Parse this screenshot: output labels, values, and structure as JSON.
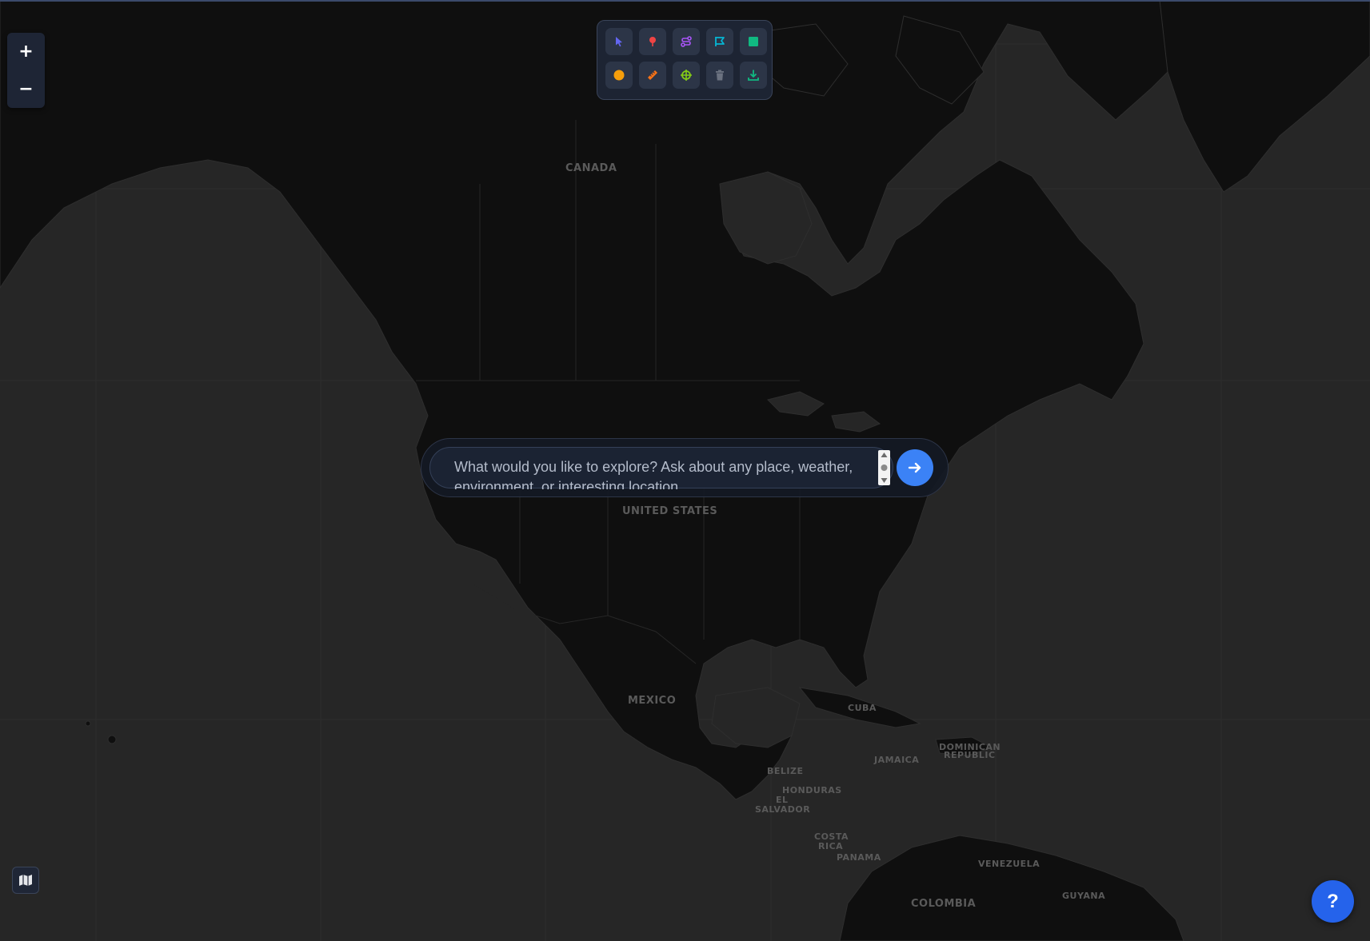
{
  "map": {
    "background_color": "#262626",
    "land_color": "#0f0f0f",
    "border_color": "#2e2e2e",
    "labels": [
      {
        "id": "canada",
        "text": "CANADA"
      },
      {
        "id": "united-states",
        "text": "UNITED STATES"
      },
      {
        "id": "mexico",
        "text": "MEXICO"
      },
      {
        "id": "cuba",
        "text": "CUBA"
      },
      {
        "id": "jamaica",
        "text": "JAMAICA"
      },
      {
        "id": "dominican-republic-1",
        "text": "DOMINICAN"
      },
      {
        "id": "dominican-republic-2",
        "text": "REPUBLIC"
      },
      {
        "id": "belize",
        "text": "BELIZE"
      },
      {
        "id": "honduras",
        "text": "HONDURAS"
      },
      {
        "id": "el-salvador-1",
        "text": "EL"
      },
      {
        "id": "el-salvador-2",
        "text": "SALVADOR"
      },
      {
        "id": "costa-rica-1",
        "text": "COSTA"
      },
      {
        "id": "costa-rica-2",
        "text": "RICA"
      },
      {
        "id": "panama",
        "text": "PANAMA"
      },
      {
        "id": "venezuela",
        "text": "VENEZUELA"
      },
      {
        "id": "colombia",
        "text": "COLOMBIA"
      },
      {
        "id": "guyana",
        "text": "GUYANA"
      }
    ]
  },
  "zoom": {
    "in_label": "+",
    "out_label": "−"
  },
  "toolbar": {
    "tools": [
      {
        "id": "select",
        "icon": "cursor-icon",
        "color": "#6366f1"
      },
      {
        "id": "marker",
        "icon": "map-pin-icon",
        "color": "#ef4444"
      },
      {
        "id": "route",
        "icon": "route-icon",
        "color": "#a855f7"
      },
      {
        "id": "polygon",
        "icon": "polygon-flag-icon",
        "color": "#06b6d4"
      },
      {
        "id": "rectangle",
        "icon": "square-icon",
        "color": "#10b981"
      },
      {
        "id": "circle",
        "icon": "circle-icon",
        "color": "#f59e0b"
      },
      {
        "id": "measure",
        "icon": "ruler-icon",
        "color": "#f97316"
      },
      {
        "id": "locate",
        "icon": "crosshair-icon",
        "color": "#84cc16"
      },
      {
        "id": "delete",
        "icon": "trash-icon",
        "color": "#6b7280"
      },
      {
        "id": "export",
        "icon": "download-icon",
        "color": "#10b981"
      }
    ]
  },
  "search": {
    "placeholder": "What would you like to explore? Ask about any place, weather, environment, or interesting location...",
    "accent_color": "#3b82f6"
  },
  "help": {
    "label": "?"
  }
}
